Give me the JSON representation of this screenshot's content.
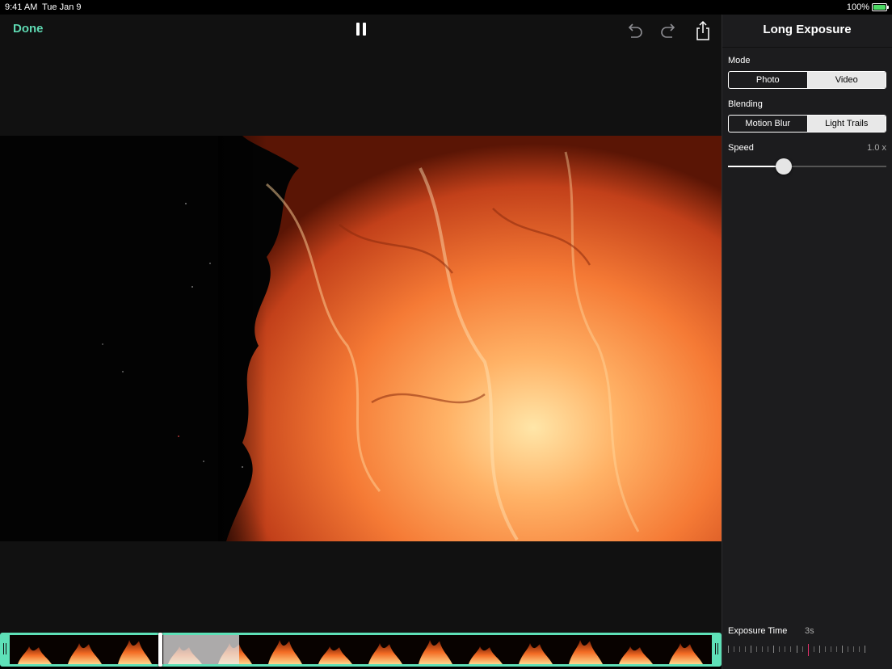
{
  "status_bar": {
    "time": "9:41 AM",
    "date": "Tue Jan 9",
    "battery": "100%"
  },
  "toolbar": {
    "done_label": "Done",
    "icons": [
      "pause-icon",
      "undo-icon",
      "redo-icon",
      "share-icon"
    ]
  },
  "panel": {
    "title": "Long Exposure",
    "mode": {
      "label": "Mode",
      "options": [
        "Photo",
        "Video"
      ],
      "selected": "Video"
    },
    "blending": {
      "label": "Blending",
      "options": [
        "Motion Blur",
        "Light Trails"
      ],
      "selected": "Light Trails"
    },
    "speed": {
      "label": "Speed",
      "value_text": "1.0 x",
      "position": 0.35
    },
    "exposure": {
      "label": "Exposure Time",
      "value_text": "3s",
      "position": 0.58
    }
  },
  "timeline": {
    "window_start": 0.22,
    "window_end": 0.33
  },
  "colors": {
    "accent": "#5ed9b2",
    "panel_bg": "#1c1c1e",
    "marker": "#e0306b"
  }
}
